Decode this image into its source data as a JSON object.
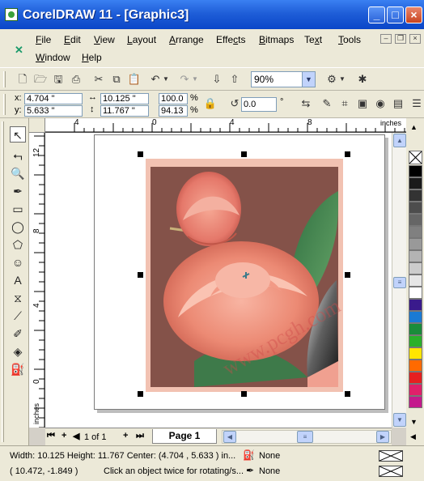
{
  "window": {
    "title": "CorelDRAW 11 - [Graphic3]",
    "minimize": "_",
    "maximize": "□",
    "close": "×"
  },
  "menu": {
    "items": [
      {
        "pre": "",
        "u": "F",
        "post": "ile"
      },
      {
        "pre": "",
        "u": "E",
        "post": "dit"
      },
      {
        "pre": "",
        "u": "V",
        "post": "iew"
      },
      {
        "pre": "",
        "u": "L",
        "post": "ayout"
      },
      {
        "pre": "",
        "u": "A",
        "post": "rrange"
      },
      {
        "pre": "Effe",
        "u": "c",
        "post": "ts"
      },
      {
        "pre": "",
        "u": "B",
        "post": "itmaps"
      },
      {
        "pre": "Te",
        "u": "x",
        "post": "t"
      },
      {
        "pre": "",
        "u": "T",
        "post": "ools"
      },
      {
        "pre": "",
        "u": "W",
        "post": "indow"
      },
      {
        "pre": "",
        "u": "H",
        "post": "elp"
      }
    ],
    "mdi_buttons": [
      "–",
      "❐",
      "×"
    ]
  },
  "toolbar": {
    "zoom_level": "90%"
  },
  "property_bar": {
    "x_label": "x:",
    "x_value": "4.704 \"",
    "y_label": "y:",
    "y_value": "5.633 \"",
    "width_value": "10.125 \"",
    "height_value": "11.767 \"",
    "scale_w": "100.0",
    "scale_h": "94.13",
    "scale_unit": "%",
    "rotation_value": "0.0",
    "rotation_unit": "°"
  },
  "rulers": {
    "units": "inches",
    "top_labels": [
      "4",
      "0",
      "4",
      "8"
    ],
    "left_labels": [
      "12",
      "8",
      "4",
      "0"
    ],
    "left_units": "inches"
  },
  "page_nav": {
    "count": "1 of 1",
    "page_tab": "Page 1"
  },
  "watermark": "www.pcgh.com",
  "palette_colors": [
    "#ffffff",
    "#000000",
    "#1a1a1a",
    "#333333",
    "#4d4d4d",
    "#666666",
    "#808080",
    "#999999",
    "#b3b3b3",
    "#cccccc",
    "#e6e6e6",
    "#ffffff",
    "#3a1a8c",
    "#1a7ad4",
    "#1a8c3a",
    "#2ab02a",
    "#ffe600",
    "#ff6a00",
    "#e62020",
    "#e0206a",
    "#c41a8c"
  ],
  "status": {
    "line1": "Width: 10.125  Height: 11.767  Center: (4.704 , 5.633 )  in...",
    "line2_coords": "( 10.472, -1.849 )",
    "line2_hint": "Click an object twice for rotating/s...",
    "fill": "None",
    "outline": "None"
  }
}
